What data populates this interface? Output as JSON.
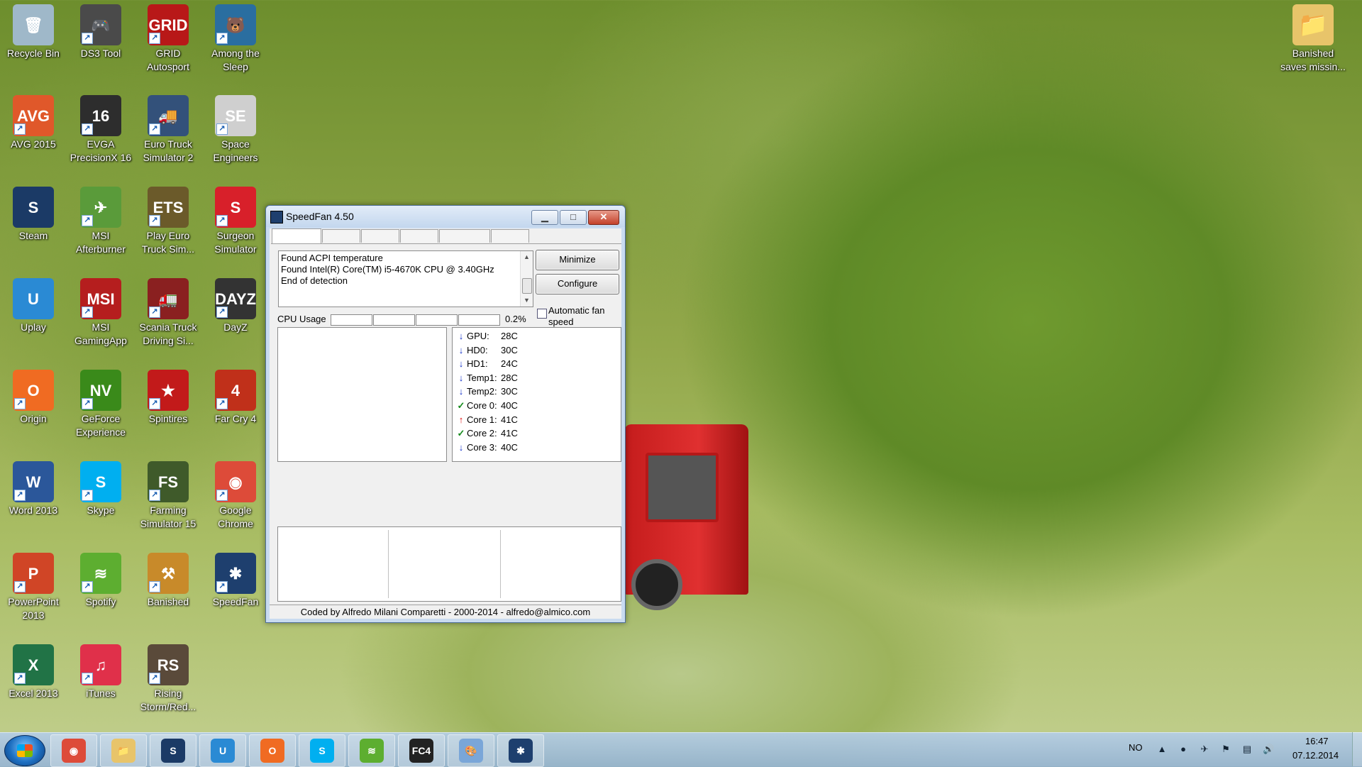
{
  "desktop": {
    "icons": [
      {
        "label": "Recycle Bin",
        "glyph": "🗑",
        "color": "#9fb8c9",
        "shortcut": false
      },
      {
        "label": "DS3 Tool",
        "glyph": "🎮",
        "color": "#4a4a4a",
        "shortcut": true
      },
      {
        "label": "GRID Autosport",
        "glyph": "GRID",
        "color": "#b81818",
        "shortcut": true
      },
      {
        "label": "Among the Sleep",
        "glyph": "🐻",
        "color": "#2a6ea0",
        "shortcut": true
      },
      {
        "label": "AVG 2015",
        "glyph": "AVG",
        "color": "#e0582a",
        "shortcut": true
      },
      {
        "label": "EVGA PrecisionX 16",
        "glyph": "16",
        "color": "#2d2d2d",
        "shortcut": true
      },
      {
        "label": "Euro Truck Simulator 2",
        "glyph": "🚚",
        "color": "#33517a",
        "shortcut": true
      },
      {
        "label": "Space Engineers",
        "glyph": "SE",
        "color": "#cfcfcf",
        "shortcut": true
      },
      {
        "label": "Steam",
        "glyph": "S",
        "color": "#1b3a66",
        "shortcut": false
      },
      {
        "label": "MSI Afterburner",
        "glyph": "✈",
        "color": "#5a9b3a",
        "shortcut": true
      },
      {
        "label": "Play Euro Truck Sim...",
        "glyph": "ETS",
        "color": "#6b5a2a",
        "shortcut": true
      },
      {
        "label": "Surgeon Simulator",
        "glyph": "S",
        "color": "#d8202a",
        "shortcut": true
      },
      {
        "label": "Uplay",
        "glyph": "U",
        "color": "#2a8ad4",
        "shortcut": false
      },
      {
        "label": "MSI GamingApp",
        "glyph": "MSI",
        "color": "#b51e1e",
        "shortcut": true
      },
      {
        "label": "Scania Truck Driving Si...",
        "glyph": "🚛",
        "color": "#8a2020",
        "shortcut": true
      },
      {
        "label": "DayZ",
        "glyph": "DAYZ",
        "color": "#333",
        "shortcut": true
      },
      {
        "label": "Origin",
        "glyph": "O",
        "color": "#f06b22",
        "shortcut": true
      },
      {
        "label": "GeForce Experience",
        "glyph": "NV",
        "color": "#3a8a1a",
        "shortcut": true
      },
      {
        "label": "Spintires",
        "glyph": "★",
        "color": "#c21a1a",
        "shortcut": true
      },
      {
        "label": "Far Cry 4",
        "glyph": "4",
        "color": "#c0301a",
        "shortcut": true
      },
      {
        "label": "Word 2013",
        "glyph": "W",
        "color": "#2b579a",
        "shortcut": true
      },
      {
        "label": "Skype",
        "glyph": "S",
        "color": "#00aff0",
        "shortcut": true
      },
      {
        "label": "Farming Simulator 15",
        "glyph": "FS",
        "color": "#3f5a2a",
        "shortcut": true
      },
      {
        "label": "Google Chrome",
        "glyph": "◉",
        "color": "#dd4b39",
        "shortcut": true
      },
      {
        "label": "PowerPoint 2013",
        "glyph": "P",
        "color": "#d04526",
        "shortcut": true
      },
      {
        "label": "Spotify",
        "glyph": "≋",
        "color": "#5dae30",
        "shortcut": true
      },
      {
        "label": "Banished",
        "glyph": "⚒",
        "color": "#c88a2a",
        "shortcut": true
      },
      {
        "label": "SpeedFan",
        "glyph": "✱",
        "color": "#1e3f6e",
        "shortcut": true
      },
      {
        "label": "Excel 2013",
        "glyph": "X",
        "color": "#217346",
        "shortcut": true
      },
      {
        "label": "iTunes",
        "glyph": "♫",
        "color": "#e0304a",
        "shortcut": true
      },
      {
        "label": "Rising Storm/Red...",
        "glyph": "RS",
        "color": "#5a4a3a",
        "shortcut": true
      }
    ],
    "folder": {
      "label": "Banished saves missin...",
      "glyph": "📁",
      "color": "#e8c46a"
    }
  },
  "speedfan": {
    "title": "SpeedFan 4.50",
    "buttons": {
      "minimize_label": "Minimize",
      "configure_label": "Configure"
    },
    "log_lines": [
      "Found ACPI temperature",
      "Found Intel(R) Core(TM) i5-4670K CPU @ 3.40GHz",
      "End of detection"
    ],
    "auto_fan_label": "Automatic fan speed",
    "auto_fan_checked": false,
    "cpu_usage_label": "CPU Usage",
    "cpu_usage_value": "0.2%",
    "temperatures": [
      {
        "name": "GPU:",
        "value": "28C",
        "status": "down"
      },
      {
        "name": "HD0:",
        "value": "30C",
        "status": "down"
      },
      {
        "name": "HD1:",
        "value": "24C",
        "status": "down"
      },
      {
        "name": "Temp1:",
        "value": "28C",
        "status": "down"
      },
      {
        "name": "Temp2:",
        "value": "30C",
        "status": "down"
      },
      {
        "name": "Core 0:",
        "value": "40C",
        "status": "ok"
      },
      {
        "name": "Core 1:",
        "value": "41C",
        "status": "up"
      },
      {
        "name": "Core 2:",
        "value": "41C",
        "status": "ok"
      },
      {
        "name": "Core 3:",
        "value": "40C",
        "status": "down"
      }
    ],
    "footer": "Coded by Alfredo Milani Comparetti - 2000-2014 - alfredo@almico.com"
  },
  "taskbar": {
    "pinned": [
      {
        "name": "Google Chrome",
        "glyph": "◉",
        "color": "#dd4b39"
      },
      {
        "name": "Windows Explorer",
        "glyph": "📁",
        "color": "#e8c46a"
      },
      {
        "name": "Steam",
        "glyph": "S",
        "color": "#1b3a66"
      },
      {
        "name": "Uplay",
        "glyph": "U",
        "color": "#2a8ad4"
      },
      {
        "name": "Origin",
        "glyph": "O",
        "color": "#f06b22"
      },
      {
        "name": "Skype",
        "glyph": "S",
        "color": "#00aff0"
      },
      {
        "name": "Spotify",
        "glyph": "≋",
        "color": "#5dae30"
      },
      {
        "name": "Far Cry 4",
        "glyph": "FC4",
        "color": "#222"
      },
      {
        "name": "Paint",
        "glyph": "🎨",
        "color": "#7aa6d8"
      },
      {
        "name": "SpeedFan",
        "glyph": "✱",
        "color": "#1e3f6e"
      }
    ],
    "language": "NO",
    "time": "16:47",
    "date": "07.12.2014"
  }
}
